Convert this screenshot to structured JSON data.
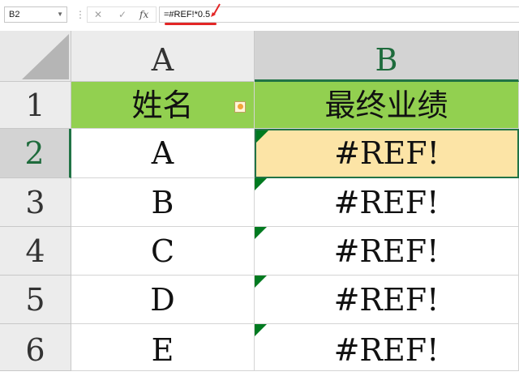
{
  "formula_bar": {
    "name_box": "B2",
    "dots": "⋮",
    "cancel_icon": "✕",
    "enter_icon": "✓",
    "fx_label": "fx",
    "formula": "=#REF!*0.5"
  },
  "columns": [
    {
      "label": "A",
      "selected": false
    },
    {
      "label": "B",
      "selected": true
    }
  ],
  "rows": [
    {
      "num": "1",
      "cells": [
        "姓名",
        "最终业绩"
      ]
    },
    {
      "num": "2",
      "cells": [
        "A",
        "#REF!"
      ]
    },
    {
      "num": "3",
      "cells": [
        "B",
        "#REF!"
      ]
    },
    {
      "num": "4",
      "cells": [
        "C",
        "#REF!"
      ]
    },
    {
      "num": "5",
      "cells": [
        "D",
        "#REF!"
      ]
    },
    {
      "num": "6",
      "cells": [
        "E",
        "#REF!"
      ]
    }
  ],
  "colors": {
    "header_fill": "#92d050",
    "active_cell_fill": "#fce4a6",
    "selection_border": "#217346",
    "error_indicator": "#007a20",
    "annotation_red": "#e32626"
  }
}
